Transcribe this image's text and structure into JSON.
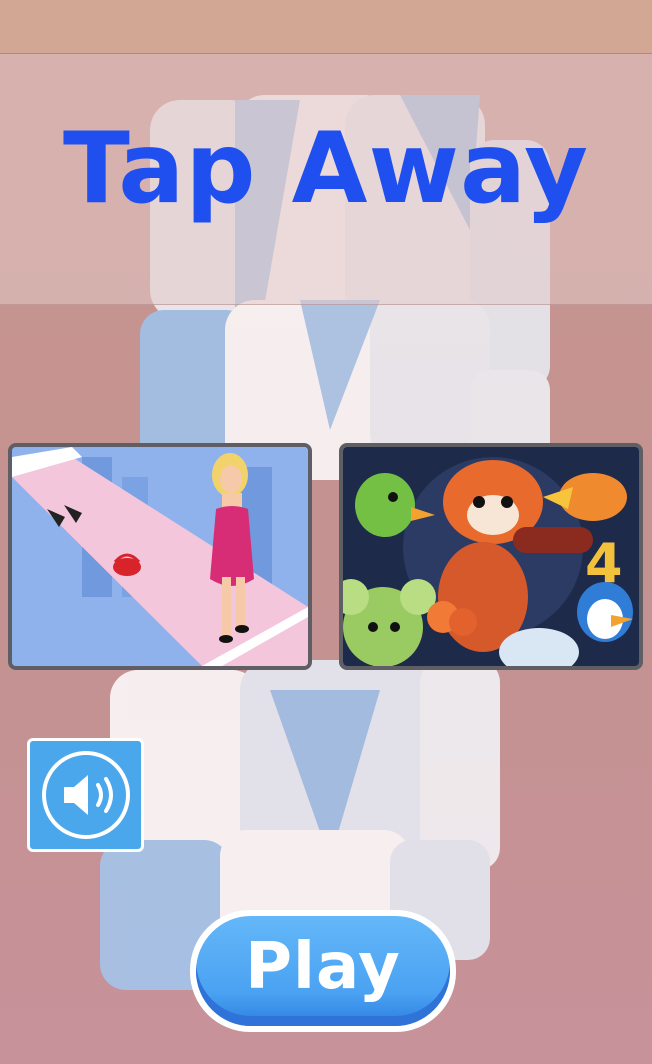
{
  "app": {
    "title": "Tap Away"
  },
  "games": [
    {
      "name": "runway-game-thumbnail",
      "theme": "fashion-runway"
    },
    {
      "name": "animal-fight-game-thumbnail",
      "badge": "4"
    }
  ],
  "controls": {
    "sound_icon": "speaker-icon",
    "play_label": "Play"
  },
  "colors": {
    "title": "#1f4fee",
    "button_blue": "#4aa7ec",
    "cube_blue": "#9fc6f0"
  }
}
